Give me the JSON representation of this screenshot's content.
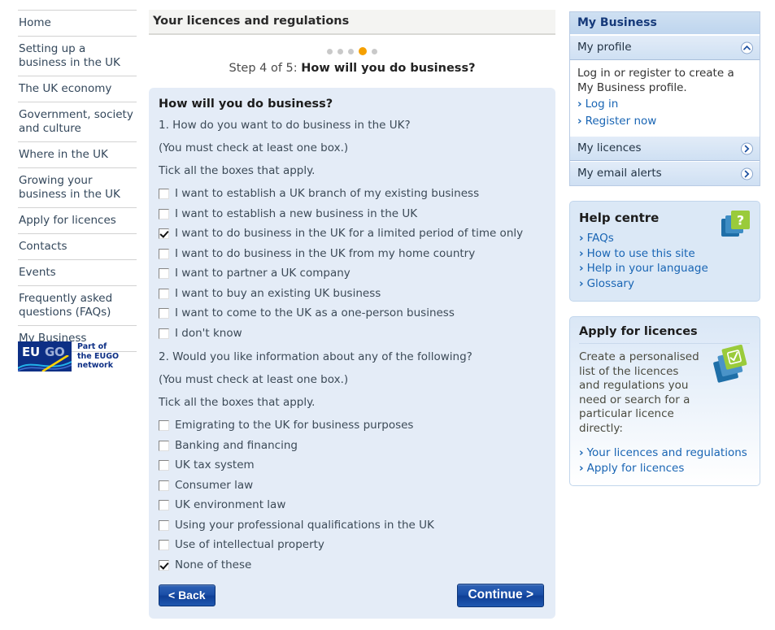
{
  "left_nav": {
    "items": [
      {
        "label": "Home"
      },
      {
        "label": "Setting up a business in the UK"
      },
      {
        "label": "The UK economy"
      },
      {
        "label": "Government, society and culture"
      },
      {
        "label": "Where in the UK"
      },
      {
        "label": "Growing your business in the UK"
      },
      {
        "label": "Apply for licences"
      },
      {
        "label": "Contacts"
      },
      {
        "label": "Events"
      },
      {
        "label": "Frequently asked questions (FAQs)"
      },
      {
        "label": "My Business"
      }
    ],
    "logo": {
      "eu": "EU",
      "go": "GO",
      "tagline": "Part of\nthe EUGO\nnetwork"
    }
  },
  "main": {
    "header_title": "Your licences and regulations",
    "step_prefix": "Step 4 of 5: ",
    "step_title": "How will you do business?",
    "dots": {
      "total": 5,
      "active_index": 3
    },
    "panel_title": "How will you do business?",
    "question1": {
      "number_text": "1. How do you want to do business in the UK?",
      "must_check": "(You must check at least one box.)",
      "tick_all": "Tick all the boxes that apply.",
      "options": [
        {
          "label": "I want to establish a UK branch of my existing business",
          "checked": false
        },
        {
          "label": "I want to establish a new business in the UK",
          "checked": false
        },
        {
          "label": "I want to do business in the UK for a limited period of time only",
          "checked": true
        },
        {
          "label": "I want to do business in the UK from my home country",
          "checked": false
        },
        {
          "label": "I want to partner a UK company",
          "checked": false
        },
        {
          "label": "I want to buy an existing UK business",
          "checked": false
        },
        {
          "label": "I want to come to the UK as a one-person business",
          "checked": false
        },
        {
          "label": "I don't know",
          "checked": false
        }
      ]
    },
    "question2": {
      "number_text": "2. Would you like information about any of the following?",
      "must_check": "(You must check at least one box.)",
      "tick_all": "Tick all the boxes that apply.",
      "options": [
        {
          "label": "Emigrating to the UK for business purposes",
          "checked": false
        },
        {
          "label": "Banking and financing",
          "checked": false
        },
        {
          "label": "UK tax system",
          "checked": false
        },
        {
          "label": "Consumer law",
          "checked": false
        },
        {
          "label": "UK environment law",
          "checked": false
        },
        {
          "label": "Using your professional qualifications in the UK",
          "checked": false
        },
        {
          "label": "Use of intellectual property",
          "checked": false
        },
        {
          "label": "None of these",
          "checked": true
        }
      ]
    },
    "back_button": "< Back",
    "continue_button": "Continue >"
  },
  "right": {
    "my_business": {
      "title": "My Business",
      "accordion": [
        {
          "label": "My profile",
          "icon": "chevron-up-icon",
          "expanded": true
        },
        {
          "label": "My licences",
          "icon": "chevron-right-icon",
          "expanded": false
        },
        {
          "label": "My email alerts",
          "icon": "chevron-right-icon",
          "expanded": false
        }
      ],
      "profile_body": "Log in or register to create a My Business profile.",
      "profile_links": [
        "Log in",
        "Register now"
      ]
    },
    "help_centre": {
      "title": "Help centre",
      "icon": "help-question-cards-icon",
      "links": [
        "FAQs",
        "How to use this site",
        "Help in your language",
        "Glossary"
      ]
    },
    "apply_licences": {
      "title": "Apply for licences",
      "icon": "checklist-cards-icon",
      "body": "Create a personalised list of the licences and regulations you need or search for a particular licence directly:",
      "links": [
        "Your licences and regulations",
        "Apply for licences"
      ]
    }
  },
  "colors": {
    "accent_orange": "#f5a000",
    "link_blue": "#1965b4",
    "panel_blue": "#e4ecf7",
    "button_blue": "#1a4fa8",
    "brand_navy": "#0d2f85",
    "icon_green": "#8cc63e"
  }
}
